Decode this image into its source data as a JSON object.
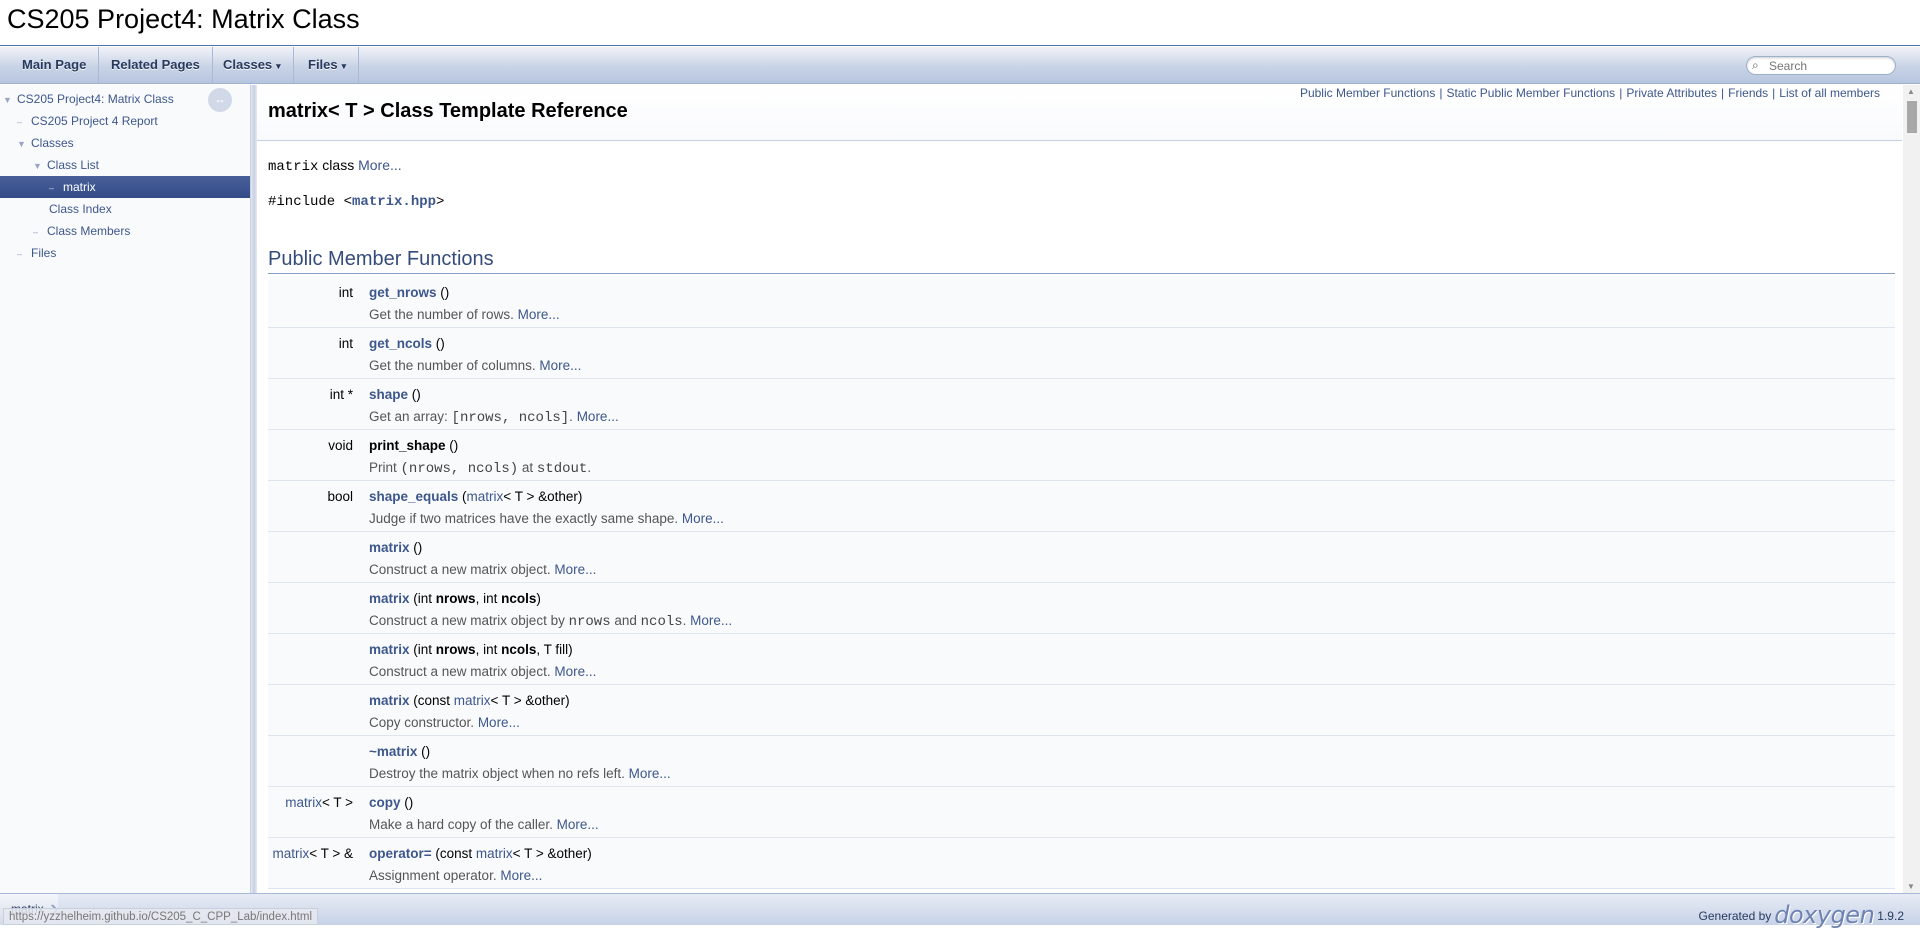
{
  "title": "CS205 Project4: Matrix Class",
  "nav": {
    "main_page": "Main Page",
    "related_pages": "Related Pages",
    "classes": "Classes",
    "files": "Files",
    "search_placeholder": "Search"
  },
  "sidebar": {
    "items": [
      {
        "label": "CS205 Project4: Matrix Class",
        "arrow": "▼"
      },
      {
        "label": "CS205 Project 4 Report",
        "arrow": "–"
      },
      {
        "label": "Classes",
        "arrow": "▼"
      },
      {
        "label": "Class List",
        "arrow": "▼"
      },
      {
        "label": "matrix",
        "arrow": "–"
      },
      {
        "label": "Class Index",
        "arrow": ""
      },
      {
        "label": "Class Members",
        "arrow": "–"
      },
      {
        "label": "Files",
        "arrow": "–"
      }
    ]
  },
  "summary_links": [
    "Public Member Functions",
    "Static Public Member Functions",
    "Private Attributes",
    "Friends",
    "List of all members"
  ],
  "page_title": "matrix< T > Class Template Reference",
  "brief": {
    "code": "matrix",
    "text": " class ",
    "more": "More..."
  },
  "include": {
    "prefix": "#include <",
    "file": "matrix.hpp",
    "suffix": ">"
  },
  "section_title": "Public Member Functions",
  "members": [
    {
      "type": "int",
      "name": "get_nrows",
      "args": " ()",
      "desc": "Get the number of rows. ",
      "more": "More..."
    },
    {
      "type": "int",
      "name": "get_ncols",
      "args": " ()",
      "desc": "Get the number of columns. ",
      "more": "More..."
    },
    {
      "type": "int *",
      "name": "shape",
      "args": " ()",
      "desc_pre": "Get an array: ",
      "desc_code": "[nrows, ncols]",
      "desc_post": ". ",
      "more": "More..."
    },
    {
      "type": "void",
      "name": "print_shape",
      "args": " ()",
      "desc_pre": "Print ",
      "desc_code": "(nrows, ncols)",
      "desc_post": " at ",
      "desc_code2": "stdout",
      "desc_post2": "."
    },
    {
      "type": "bool",
      "name": "shape_equals",
      "args_pre": " (",
      "args_link": "matrix",
      "args_post": "< T > &other)",
      "desc": "Judge if two matrices have the exactly same shape. ",
      "more": "More..."
    },
    {
      "type": "",
      "name": "matrix",
      "args": " ()",
      "desc": "Construct a new matrix object. ",
      "more": "More..."
    },
    {
      "type": "",
      "name": "matrix",
      "args_pre": " (int ",
      "args_bold1": "nrows",
      "args_mid": ", int ",
      "args_bold2": "ncols",
      "args_post": ")",
      "desc_pre": "Construct a new matrix object by ",
      "desc_code": "nrows",
      "desc_post": " and ",
      "desc_code2": "ncols",
      "desc_post2": ". ",
      "more": "More..."
    },
    {
      "type": "",
      "name": "matrix",
      "args_pre": " (int ",
      "args_bold1": "nrows",
      "args_mid": ", int ",
      "args_bold2": "ncols",
      "args_post": ", T fill)",
      "desc": "Construct a new matrix object. ",
      "more": "More..."
    },
    {
      "type": "",
      "name": "matrix",
      "args_pre": " (const ",
      "args_link": "matrix",
      "args_post": "< T > &other)",
      "desc": "Copy constructor. ",
      "more": "More..."
    },
    {
      "type": "",
      "name": "~matrix",
      "args": " ()",
      "desc": "Destroy the matrix object when no refs left. ",
      "more": "More..."
    },
    {
      "type_link": "matrix",
      "type_post": "< T >",
      "name": "copy",
      "args": " ()",
      "desc": "Make a hard copy of the caller. ",
      "more": "More..."
    },
    {
      "type_link": "matrix",
      "type_post": "< T > &",
      "name": "operator=",
      "args_pre": " (const ",
      "args_link": "matrix",
      "args_post": "< T > &other)",
      "desc": "Assignment operator. ",
      "more": "More..."
    }
  ],
  "footer": {
    "crumb": "matrix",
    "status_url": "https://yzzhelheim.github.io/CS205_C_CPP_Lab/index.html",
    "generated_by": "Generated by",
    "logo": "doxygen",
    "version": "1.9.2"
  },
  "colors": {
    "link": "#3d578c",
    "section": "#354c7b",
    "selected": "#334b87"
  }
}
